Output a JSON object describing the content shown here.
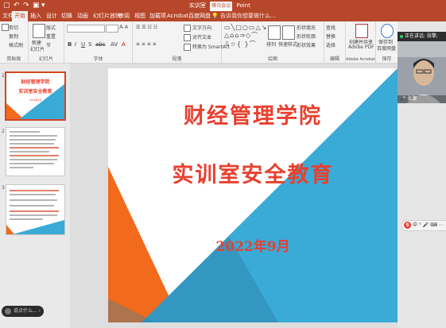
{
  "titlebar": {
    "title_left": "实训室",
    "tag": "腾讯会议",
    "title_right": "Point"
  },
  "tabs": [
    {
      "label": "文件"
    },
    {
      "label": "开始"
    },
    {
      "label": "插入"
    },
    {
      "label": "设计"
    },
    {
      "label": "切换"
    },
    {
      "label": "动画"
    },
    {
      "label": "幻灯片放映"
    },
    {
      "label": "审阅"
    },
    {
      "label": "视图"
    },
    {
      "label": "加载项"
    },
    {
      "label": "Acrobat"
    },
    {
      "label": "百度网盘"
    }
  ],
  "tell_me": "告诉我你想要做什么...",
  "ribbon": {
    "clipboard": {
      "cut": "剪切",
      "copy": "复制",
      "format_painter": "格式刷",
      "label": "剪贴板"
    },
    "slides": {
      "new_slide": "新建",
      "new_slide2": "幻灯片",
      "layout": "版式",
      "reset": "重置",
      "section": "节",
      "label": "幻灯片"
    },
    "font": {
      "label": "字体"
    },
    "paragraph": {
      "text_direction": "文字方向",
      "align_text": "对齐文本",
      "smartart": "转换为 SmartArt",
      "label": "段落"
    },
    "drawing": {
      "arrange": "排列",
      "quick_styles": "快速样式",
      "shape_fill": "形状填充",
      "shape_outline": "形状轮廓",
      "shape_effects": "形状效果",
      "label": "绘图"
    },
    "editing": {
      "find": "查找",
      "replace": "替换",
      "select": "选择",
      "label": "编辑"
    },
    "acrobat": {
      "create": "创建并共享",
      "pdf": "Adobe PDF",
      "label": "Adobe Acrobat"
    },
    "save": {
      "save_to": "保存到",
      "baidu": "百度网盘",
      "label": "保存"
    }
  },
  "thumbnails": [
    {
      "num": "1",
      "title1": "财经管理学院",
      "title2": "实训室安全教育",
      "date": "2022年9月"
    },
    {
      "num": "2"
    },
    {
      "num": "3"
    }
  ],
  "slide": {
    "title1": "财经管理学院",
    "title2": "实训室安全教育",
    "date": "2022年9月"
  },
  "meeting": {
    "speaking_label": "正在讲话: 张擎;",
    "participant": "张擎"
  },
  "ime": {
    "logo": "S",
    "items": "中 ° 🎤 ⌨ ⋯"
  },
  "bubble": {
    "label": "说点什么..."
  },
  "colors": {
    "accent": "#b7472a",
    "slide_red": "#e8402f",
    "slide_orange": "#f26a1b",
    "slide_blue": "#3aaad6",
    "slide_darkblue": "#2f80a8"
  }
}
